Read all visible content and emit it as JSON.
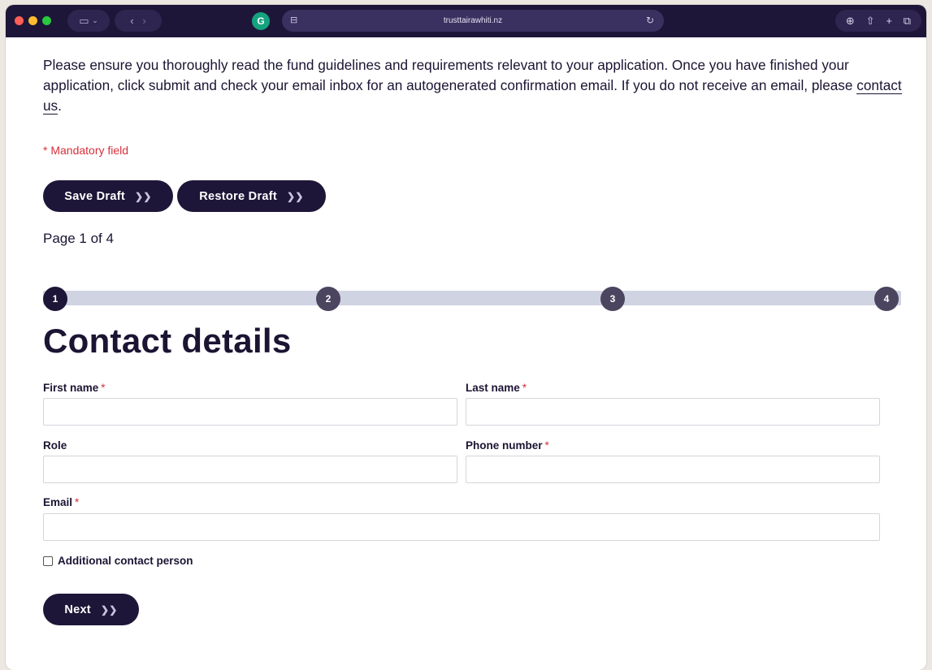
{
  "browser": {
    "url": "trusttairawhiti.nz",
    "traffic_colors": [
      "#ff5f57",
      "#febc2e",
      "#28c840"
    ],
    "grammarly_label": "G"
  },
  "intro": {
    "text_before_link": "Please ensure you thoroughly read the fund guidelines and requirements relevant to your application. Once you have finished your application, click submit and check your email inbox for an autogenerated confirmation email. If you do not receive an email, please ",
    "link_text": "contact us",
    "text_after_link": "."
  },
  "mandatory_note": "* Mandatory field",
  "draft_buttons": {
    "save_label": "Save Draft",
    "restore_label": "Restore Draft"
  },
  "pagination": {
    "text": "Page 1 of 4",
    "current_step": 1,
    "steps": [
      "1",
      "2",
      "3",
      "4"
    ]
  },
  "section_title": "Contact details",
  "form": {
    "first_name": {
      "label": "First name",
      "required": "*",
      "value": ""
    },
    "last_name": {
      "label": "Last name",
      "required": "*",
      "value": ""
    },
    "role": {
      "label": "Role",
      "value": ""
    },
    "phone": {
      "label": "Phone number",
      "required": "*",
      "value": ""
    },
    "email": {
      "label": "Email",
      "required": "*",
      "value": ""
    },
    "additional_contact": {
      "label": "Additional contact person",
      "checked": false
    }
  },
  "next_label": "Next",
  "colors": {
    "brand_dark": "#1e1638",
    "required_red": "#d6303a",
    "progress_track": "#cfd3e2",
    "step_inactive": "#4b4560"
  }
}
